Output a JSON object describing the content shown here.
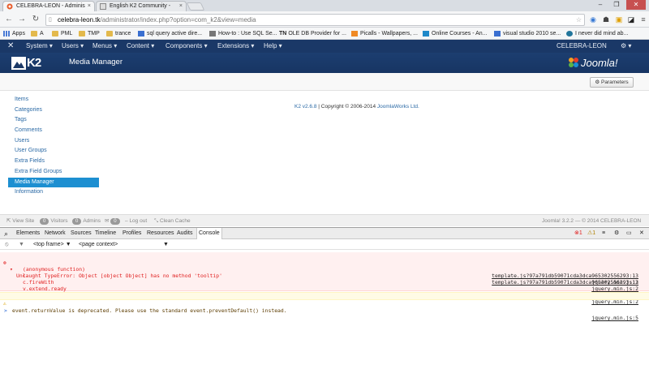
{
  "browser": {
    "tabs": [
      {
        "label": "CELEBRA-LEON - Adminis",
        "active": true
      },
      {
        "label": "English K2 Community - ",
        "active": false
      }
    ],
    "url": {
      "domain": "celebra-leon.tk",
      "path": "/administrator/index.php?option=com_k2&view=media"
    },
    "bookmarks": [
      "Apps",
      "A",
      "PML",
      "TMP",
      "trance",
      "sql query active dire...",
      "How-to : Use SQL Se...",
      "OLE DB Provider for ...",
      "Picalls - Wallpapers, ...",
      "Online Courses - An...",
      "visual studio 2010 se...",
      "I never did mind ab..."
    ],
    "bookmark_prefix_tn": "TN"
  },
  "joomla": {
    "menu": [
      "System",
      "Users",
      "Menus",
      "Content",
      "Components",
      "Extensions",
      "Help"
    ],
    "site_name": "CELEBRA-LEON",
    "settings_icon": "gear-icon",
    "logo_text": "K2",
    "page_title": "Media Manager",
    "joomla_logo": "Joomla!",
    "params_button": "Parameters",
    "sidebar": [
      {
        "label": "Items",
        "active": false
      },
      {
        "label": "Categories",
        "active": false
      },
      {
        "label": "Tags",
        "active": false
      },
      {
        "label": "Comments",
        "active": false
      },
      {
        "label": "Users",
        "active": false
      },
      {
        "label": "User Groups",
        "active": false
      },
      {
        "label": "Extra Fields",
        "active": false
      },
      {
        "label": "Extra Field Groups",
        "active": false
      },
      {
        "label": "Media Manager",
        "active": true
      },
      {
        "label": "Information",
        "active": false
      }
    ],
    "copyright": {
      "version": "K2 v2.6.8",
      "text": " | Copyright © 2006-2014 ",
      "company": "JoomlaWorks Ltd."
    },
    "status": {
      "view_site": "View Site",
      "visitors_count": "0",
      "visitors": "Visitors",
      "admins_count": "0",
      "admins": "Admins",
      "messages_count": "0",
      "logout": "Log out",
      "clean_cache": "Clean Cache",
      "right": "Joomla! 3.2.2  —  © 2014 CELEBRA-LEON"
    }
  },
  "devtools": {
    "tabs": [
      "Elements",
      "Network",
      "Sources",
      "Timeline",
      "Profiles",
      "Resources",
      "Audits",
      "Console"
    ],
    "active_tab": "Console",
    "error_count": "1",
    "warn_count": "1",
    "frame": "<top frame>",
    "context": "<page context>",
    "console": [
      {
        "type": "error",
        "text": "Uncaught TypeError: Object [object Object] has no method 'tooltip'",
        "src": "template.js?97a791db59071cda3dca965302556293:13"
      },
      {
        "type": "stack",
        "text": "(anonymous function)",
        "src": "template.js?97a791db59071cda3dca965302556293:13"
      },
      {
        "type": "stack",
        "text": "l",
        "src": "jquery.min.js:2"
      },
      {
        "type": "stack",
        "text": "c.fireWith",
        "src": "jquery.min.js:2"
      },
      {
        "type": "stack",
        "text": "v.extend.ready",
        "src": "jquery.min.js:2"
      },
      {
        "type": "stack",
        "text": "A",
        "src": "jquery.min.js:2"
      },
      {
        "type": "warn",
        "text": "event.returnValue is deprecated. Please use the standard event.preventDefault() instead.",
        "src": "jquery.min.js:5"
      }
    ],
    "prompt": ">"
  },
  "colors": {
    "joomla_nav": "#1a3867",
    "active_sidebar": "#1d8fd1",
    "link": "#2a69a5",
    "error": "#e02020"
  }
}
